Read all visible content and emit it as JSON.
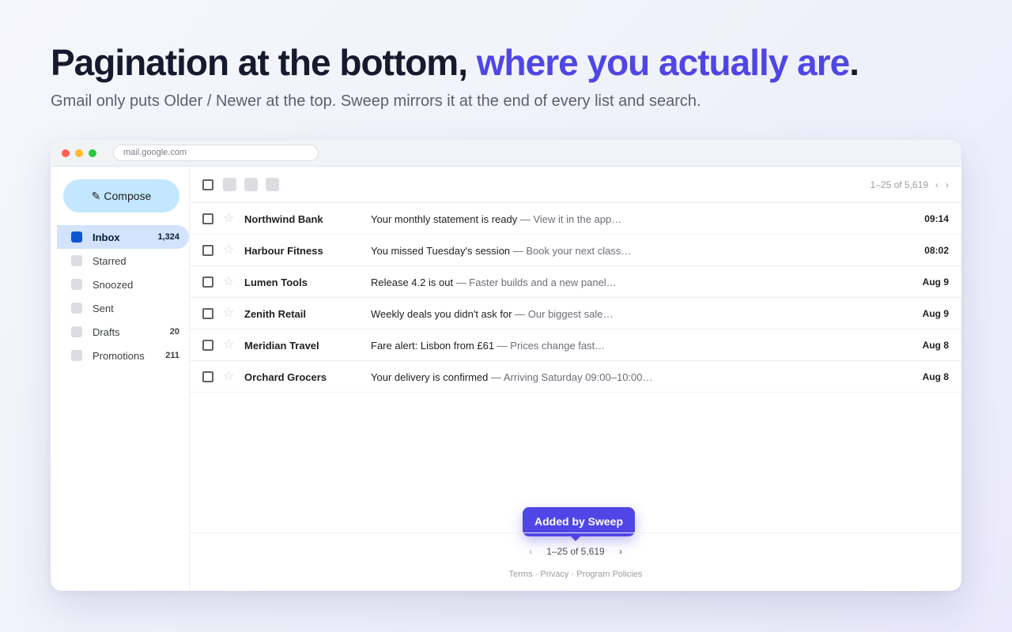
{
  "hero": {
    "title_main": "Pagination at the bottom, ",
    "title_accent": "where you actually are",
    "title_end": ".",
    "subtitle": "Gmail only puts Older / Newer at the top. Sweep mirrors it at the end of every list and search."
  },
  "browser": {
    "url": "mail.google.com"
  },
  "sidebar": {
    "compose_icon": "✎",
    "compose_label": "Compose",
    "items": [
      {
        "label": "Inbox",
        "count": "1,324",
        "active": true
      },
      {
        "label": "Starred",
        "count": ""
      },
      {
        "label": "Snoozed",
        "count": ""
      },
      {
        "label": "Sent",
        "count": ""
      },
      {
        "label": "Drafts",
        "count": "20"
      },
      {
        "label": "Promotions",
        "count": "211"
      }
    ]
  },
  "toolbar": {
    "range": "1–25 of 5,619",
    "prev": "‹",
    "next": "›"
  },
  "emails": [
    {
      "sender": "Northwind Bank",
      "subject": "Your monthly statement is ready",
      "snippet": " — View it in the app…",
      "time": "09:14"
    },
    {
      "sender": "Harbour Fitness",
      "subject": "You missed Tuesday's session",
      "snippet": " — Book your next class…",
      "time": "08:02"
    },
    {
      "sender": "Lumen Tools",
      "subject": "Release 4.2 is out",
      "snippet": " — Faster builds and a new panel…",
      "time": "Aug 9"
    },
    {
      "sender": "Zenith Retail",
      "subject": "Weekly deals you didn't ask for",
      "snippet": " — Our biggest sale…",
      "time": "Aug 9"
    },
    {
      "sender": "Meridian Travel",
      "subject": "Fare alert: Lisbon from £61",
      "snippet": " — Prices change fast…",
      "time": "Aug 8"
    },
    {
      "sender": "Orchard Grocers",
      "subject": "Your delivery is confirmed",
      "snippet": " — Arriving Saturday 09:00–10:00…",
      "time": "Aug 8"
    }
  ],
  "tooltip": {
    "label": "Added by Sweep"
  },
  "bottom_pager": {
    "prev": "‹",
    "range": "1–25 of 5,619",
    "next": "›"
  },
  "footer": {
    "terms": "Terms",
    "privacy": "Privacy",
    "policies": "Program Policies",
    "separator": " · "
  },
  "colors": {
    "accent": "#4f46e5",
    "compose_bg": "#c2e7ff",
    "active_nav_bg": "#d3e3fd",
    "active_nav_icon": "#0b57d0"
  },
  "icons": {
    "star": "☆",
    "compose": "pencil-icon"
  }
}
